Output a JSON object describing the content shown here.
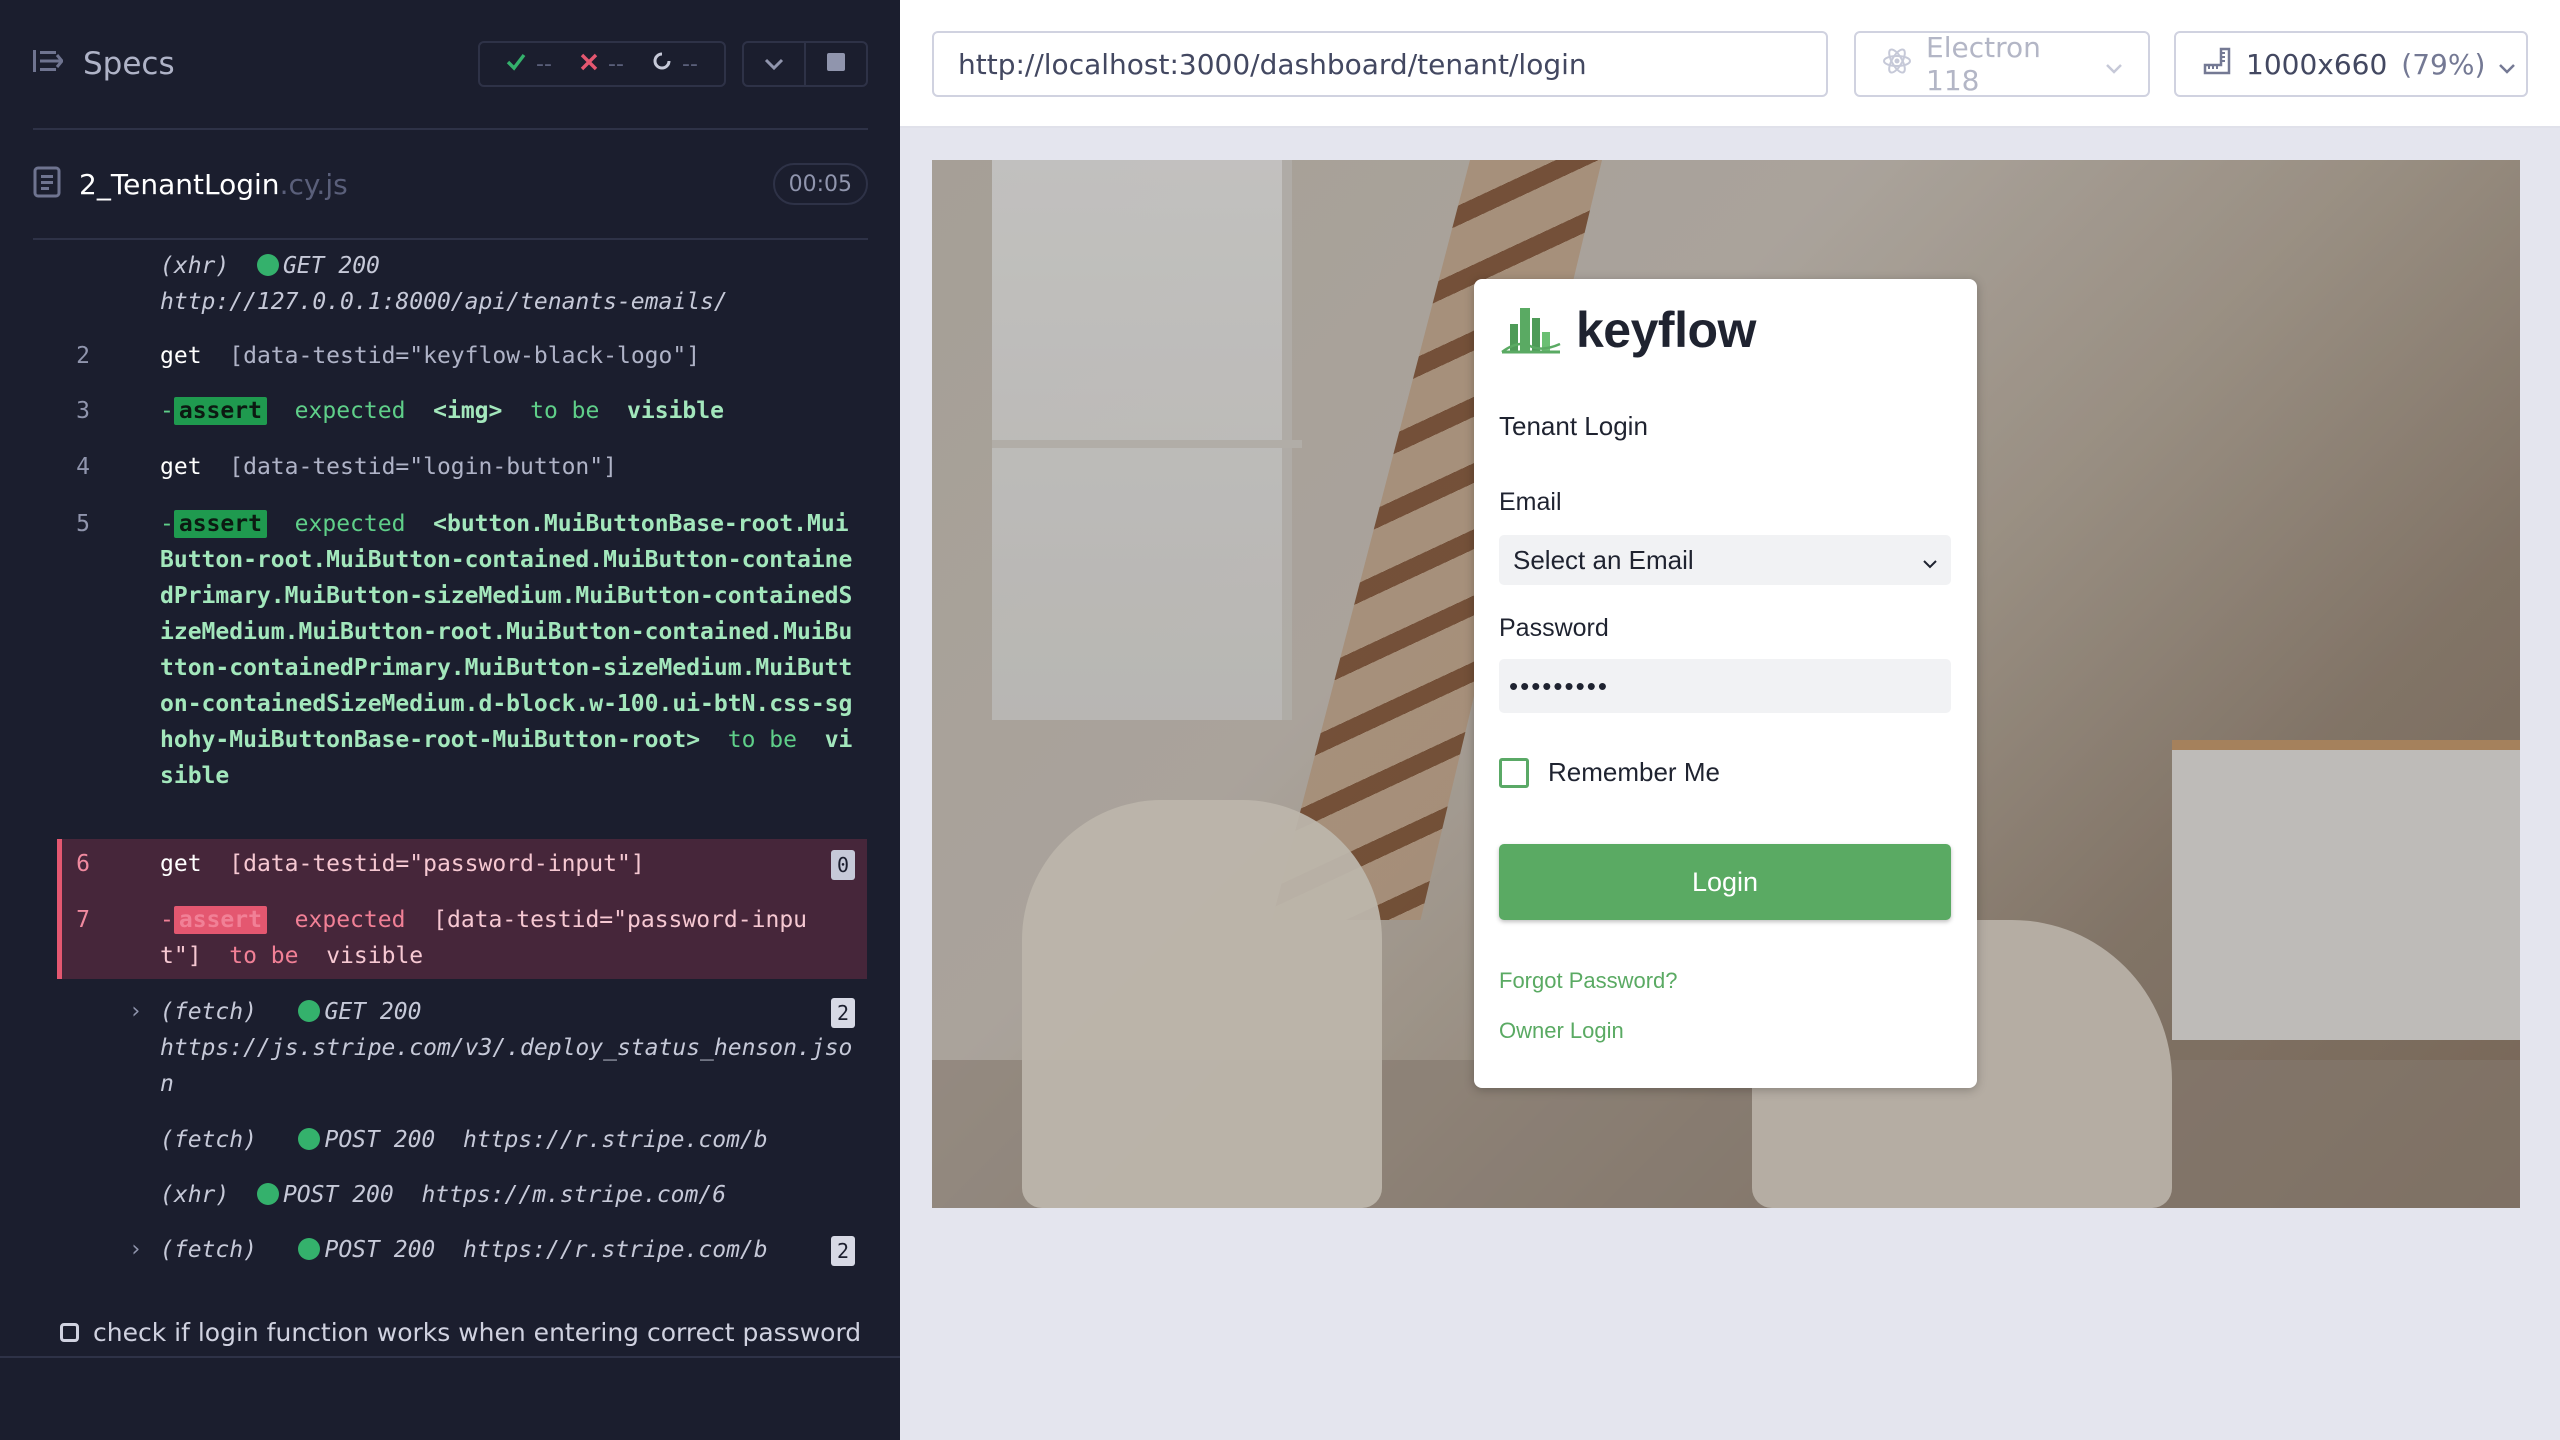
{
  "runner": {
    "specs_label": "Specs",
    "stats": {
      "passed": "--",
      "failed": "--",
      "pending": "--"
    },
    "spec_file": {
      "name": "2_TenantLogin",
      "ext": ".cy.js",
      "duration": "00:05"
    },
    "test_title": "check if login function works when entering correct password"
  },
  "commands": {
    "c0": {
      "type": "(xhr)",
      "method": "GET 200",
      "url": "http://127.0.0.1:8000/api/tenants-emails/"
    },
    "c2": {
      "num": "2",
      "name": "get",
      "selector": "[data-testid=\"keyflow-black-logo\"]"
    },
    "c3": {
      "num": "3",
      "badge": "assert",
      "text1": "expected",
      "text2": "<img>",
      "text3": "to be",
      "text4": "visible"
    },
    "c4": {
      "num": "4",
      "name": "get",
      "selector": "[data-testid=\"login-button\"]"
    },
    "c5": {
      "num": "5",
      "badge": "assert",
      "text1": "expected",
      "element": "<button.MuiButtonBase-root.MuiButton-root.MuiButton-contained.MuiButton-containedPrimary.MuiButton-sizeMedium.MuiButton-containedSizeMedium.MuiButton-root.MuiButton-contained.MuiButton-containedPrimary.MuiButton-sizeMedium.MuiButton-containedSizeMedium.d-block.w-100.ui-btN.css-sghohy-MuiButtonBase-root-MuiButton-root>",
      "text3": "to be",
      "text4": "visible"
    },
    "c6": {
      "num": "6",
      "name": "get",
      "selector": "[data-testid=\"password-input\"]",
      "count": "0"
    },
    "c7": {
      "num": "7",
      "badge": "assert",
      "text1": "expected",
      "element": "[data-testid=\"password-input\"]",
      "text3": "to be",
      "text4": "visible"
    },
    "c8": {
      "type": "(fetch)",
      "method": "GET 200",
      "url": "https://js.stripe.com/v3/.deploy_status_henson.json",
      "count": "2"
    },
    "c9": {
      "type": "(fetch)",
      "method": "POST 200",
      "url": "https://r.stripe.com/b"
    },
    "c10": {
      "type": "(xhr)",
      "method": "POST 200",
      "url": "https://m.stripe.com/6"
    },
    "c11": {
      "type": "(fetch)",
      "method": "POST 200",
      "url": "https://r.stripe.com/b",
      "count": "2"
    }
  },
  "toolbar": {
    "url": "http://localhost:3000/dashboard/tenant/login",
    "browser": "Electron 118",
    "viewport": "1000x660",
    "zoom": "(79%)"
  },
  "app": {
    "logo_text": "keyflow",
    "title": "Tenant Login",
    "email_label": "Email",
    "email_selected": "Select an Email",
    "password_label": "Password",
    "password_value": "•••••••••",
    "remember_label": "Remember Me",
    "login_label": "Login",
    "forgot_label": "Forgot Password?",
    "owner_label": "Owner Login"
  },
  "colors": {
    "runner_bg": "#1b1e2e",
    "pass_green": "#34b16c",
    "fail_red": "#e45770",
    "brand_green": "#5aaa63"
  }
}
